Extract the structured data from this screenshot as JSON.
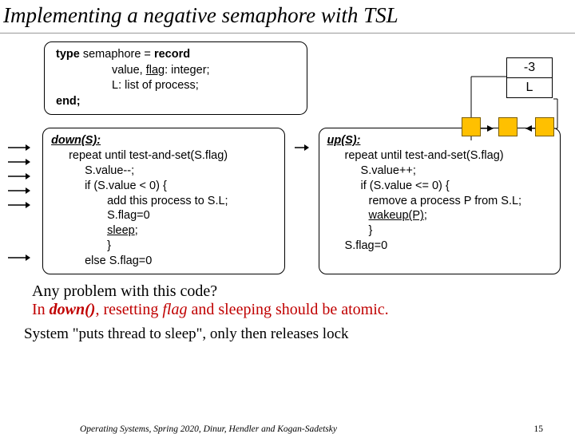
{
  "title": "Implementing a negative semaphore with TSL",
  "typedef": {
    "l1a": "type",
    "l1b": " semaphore = ",
    "l1c": "record",
    "l2a": "value, ",
    "l2b": "flag",
    "l2c": ": integer;",
    "l3a": "L",
    "l3b": ": list of process;",
    "l4": "end;"
  },
  "sem": {
    "value": "-3",
    "list": "L"
  },
  "down": {
    "head": "down(S):",
    "l1": "repeat until test-and-set(S.flag)",
    "l2": "S.value--;",
    "l3": "if (S.value < 0) {",
    "l4": "add this process to S.L;",
    "l5": "S.flag=0",
    "l6": "sleep",
    "l6b": ";",
    "l7": "}",
    "l8": "else S.flag=0"
  },
  "up": {
    "head": "up(S):",
    "l1": "repeat until test-and-set(S.flag)",
    "l2": "S.value++;",
    "l3": "if (S.value <= 0) {",
    "l4": "remove a process P from S.L;",
    "l5": "wakeup(P)",
    "l5b": ";",
    "l6": "}",
    "l7": "S.flag=0"
  },
  "question": "Any problem with this code?",
  "answer_a": "In ",
  "answer_b": "down()",
  "answer_c": ", resetting ",
  "answer_d": "flag",
  "answer_e": " and sleeping should be atomic.",
  "sys": "System \"puts thread to sleep\", only then releases lock",
  "footer": "Operating Systems,  Spring 2020, Dinur,  Hendler and Kogan-Sadetsky",
  "page": "15"
}
